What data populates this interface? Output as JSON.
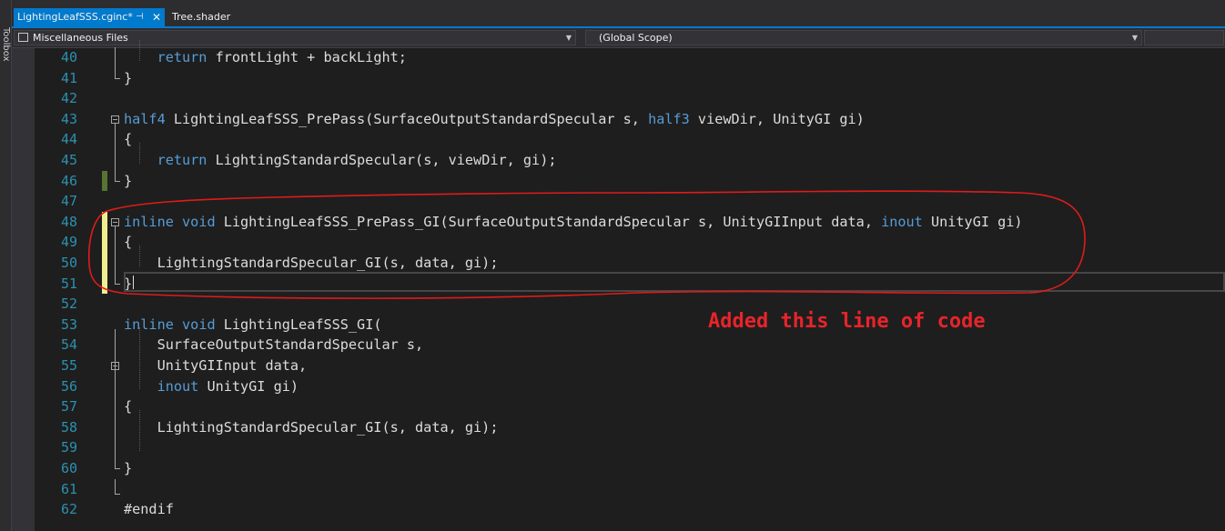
{
  "toolbox": {
    "label": "Toolbox"
  },
  "tabs": [
    {
      "label": "LightingLeafSSS.cginc*",
      "active": true
    },
    {
      "label": "Tree.shader",
      "active": false
    }
  ],
  "navigation": {
    "project": "Miscellaneous Files",
    "scope": "(Global Scope)"
  },
  "editor": {
    "lines": [
      {
        "num": "40",
        "text": "    return frontLight + backLight;"
      },
      {
        "num": "41",
        "text": "}"
      },
      {
        "num": "42",
        "text": ""
      },
      {
        "num": "43",
        "text": "half4 LightingLeafSSS_PrePass(SurfaceOutputStandardSpecular s, half3 viewDir, UnityGI gi)"
      },
      {
        "num": "44",
        "text": "{"
      },
      {
        "num": "45",
        "text": "    return LightingStandardSpecular(s, viewDir, gi);"
      },
      {
        "num": "46",
        "text": "}"
      },
      {
        "num": "47",
        "text": ""
      },
      {
        "num": "48",
        "text": "inline void LightingLeafSSS_PrePass_GI(SurfaceOutputStandardSpecular s, UnityGIInput data, inout UnityGI gi)"
      },
      {
        "num": "49",
        "text": "{"
      },
      {
        "num": "50",
        "text": "    LightingStandardSpecular_GI(s, data, gi);"
      },
      {
        "num": "51",
        "text": "}"
      },
      {
        "num": "52",
        "text": ""
      },
      {
        "num": "53",
        "text": "inline void LightingLeafSSS_GI("
      },
      {
        "num": "54",
        "text": "    SurfaceOutputStandardSpecular s,"
      },
      {
        "num": "55",
        "text": "    UnityGIInput data,"
      },
      {
        "num": "56",
        "text": "    inout UnityGI gi)"
      },
      {
        "num": "57",
        "text": "{"
      },
      {
        "num": "58",
        "text": "    LightingStandardSpecular_GI(s, data, gi);"
      },
      {
        "num": "59",
        "text": ""
      },
      {
        "num": "60",
        "text": "}"
      },
      {
        "num": "61",
        "text": ""
      },
      {
        "num": "62",
        "text": "#endif"
      }
    ],
    "keywords": [
      "half4",
      "half3",
      "inline",
      "void",
      "inout",
      "return"
    ]
  },
  "annotation": {
    "text": "Added this line of code",
    "color": "#e8242a"
  }
}
